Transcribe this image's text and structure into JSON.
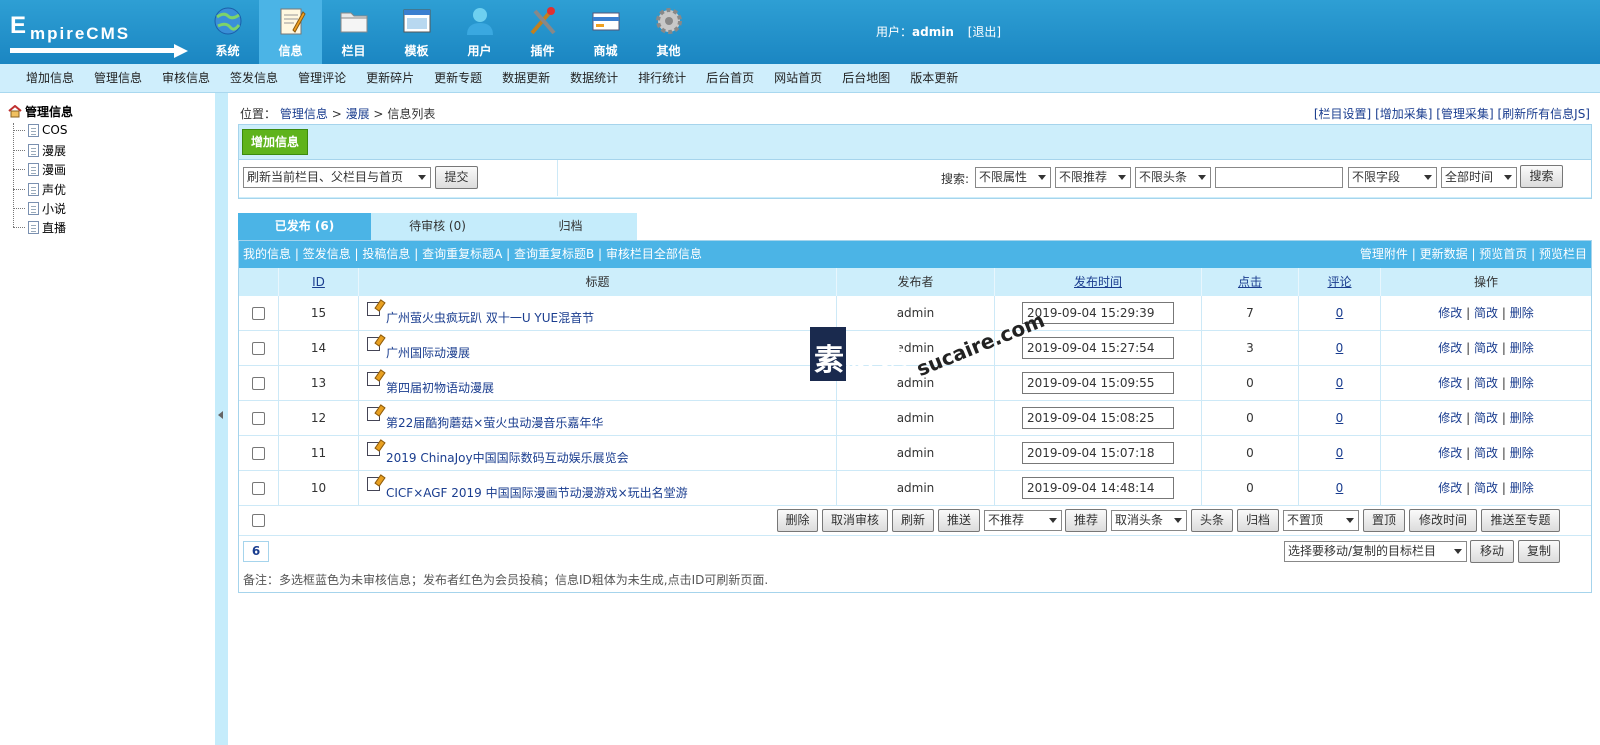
{
  "brand": {
    "logo_text": "EmpireCMS"
  },
  "topnav": [
    {
      "label": "系统",
      "icon": "globe-icon"
    },
    {
      "label": "信息",
      "icon": "document-edit-icon",
      "active": true
    },
    {
      "label": "栏目",
      "icon": "folder-icon"
    },
    {
      "label": "模板",
      "icon": "window-template-icon"
    },
    {
      "label": "用户",
      "icon": "user-icon"
    },
    {
      "label": "插件",
      "icon": "tools-icon"
    },
    {
      "label": "商城",
      "icon": "shop-card-icon"
    },
    {
      "label": "其他",
      "icon": "gear-icon"
    }
  ],
  "user": {
    "prefix": "用户：",
    "name": "admin",
    "logout": "[退出]"
  },
  "subnav": [
    "增加信息",
    "管理信息",
    "审核信息",
    "签发信息",
    "管理评论",
    "更新碎片",
    "更新专题",
    "数据更新",
    "数据统计",
    "排行统计",
    "后台首页",
    "网站首页",
    "后台地图",
    "版本更新"
  ],
  "sidebar": {
    "root": "管理信息",
    "items": [
      "COS",
      "漫展",
      "漫画",
      "声优",
      "小说",
      "直播"
    ]
  },
  "breadcrumb": {
    "prefix": "位置：",
    "items": [
      "管理信息",
      "漫展",
      "信息列表"
    ],
    "sep": ">"
  },
  "top_links": [
    "[栏目设置]",
    "[增加采集]",
    "[管理采集]",
    "[刷新所有信息JS]"
  ],
  "add_button": "增加信息",
  "refresh_select": "刷新当前栏目、父栏目与首页",
  "submit_label": "提交",
  "search": {
    "label": "搜索:",
    "attr": "不限属性",
    "recommend": "不限推荐",
    "headline": "不限头条",
    "keyword": "",
    "field": "不限字段",
    "time": "全部时间",
    "button": "搜索"
  },
  "tabs": [
    "已发布 (6)",
    "待审核 (0)",
    "归档"
  ],
  "linkbar": {
    "left": [
      "我的信息",
      "签发信息",
      "投稿信息",
      "查询重复标题A",
      "查询重复标题B",
      "审核栏目全部信息"
    ],
    "right": [
      "管理附件",
      "更新数据",
      "预览首页",
      "预览栏目"
    ]
  },
  "columns": [
    "ID",
    "标题",
    "发布者",
    "发布时间",
    "点击",
    "评论",
    "操作"
  ],
  "rows": [
    {
      "id": "15",
      "title": "广州萤火虫疯玩趴 双十一U YUE混音节",
      "author": "admin",
      "time": "2019-09-04 15:29:39",
      "hits": "7",
      "comments": "0"
    },
    {
      "id": "14",
      "title": "广州国际动漫展",
      "author": "admin",
      "time": "2019-09-04 15:27:54",
      "hits": "3",
      "comments": "0"
    },
    {
      "id": "13",
      "title": "第四届初物语动漫展",
      "author": "admin",
      "time": "2019-09-04 15:09:55",
      "hits": "0",
      "comments": "0"
    },
    {
      "id": "12",
      "title": "第22届酷狗蘑菇×萤火虫动漫音乐嘉年华",
      "author": "admin",
      "time": "2019-09-04 15:08:25",
      "hits": "0",
      "comments": "0"
    },
    {
      "id": "11",
      "title": "2019 ChinaJoy中国国际数码互动娱乐展览会",
      "author": "admin",
      "time": "2019-09-04 15:07:18",
      "hits": "0",
      "comments": "0"
    },
    {
      "id": "10",
      "title": "CICF×AGF 2019 中国国际漫画节动漫游戏×玩出名堂游",
      "author": "admin",
      "time": "2019-09-04 14:48:14",
      "hits": "0",
      "comments": "0"
    }
  ],
  "row_ops": {
    "edit": "修改",
    "quick_edit": "简改",
    "delete": "删除",
    "sep": "|"
  },
  "actions": {
    "delete": "删除",
    "unaudit": "取消审核",
    "refresh": "刷新",
    "push": "推送",
    "no_recommend": "不推荐",
    "recommend": "推荐",
    "cancel_headline": "取消头条",
    "headline": "头条",
    "archive": "归档",
    "no_top": "不置顶",
    "top": "置顶",
    "modify_time": "修改时间",
    "push_topic": "推送至专题"
  },
  "page": {
    "count": "6",
    "move_select": "选择要移动/复制的目标栏目",
    "move": "移动",
    "copy": "复制"
  },
  "note": "备注：多选框蓝色为未审核信息；发布者红色为会员投稿；信息ID粗体为未生成,点击ID可刷新页面.",
  "watermark": {
    "text": "素材熟",
    "site": "sucaire.com"
  },
  "colors": {
    "header": "#1b86c2",
    "subnav": "#cfeefc",
    "tab_active": "#4bb4e6",
    "link": "#1a3d8f",
    "add_button": "#5fb31c"
  }
}
